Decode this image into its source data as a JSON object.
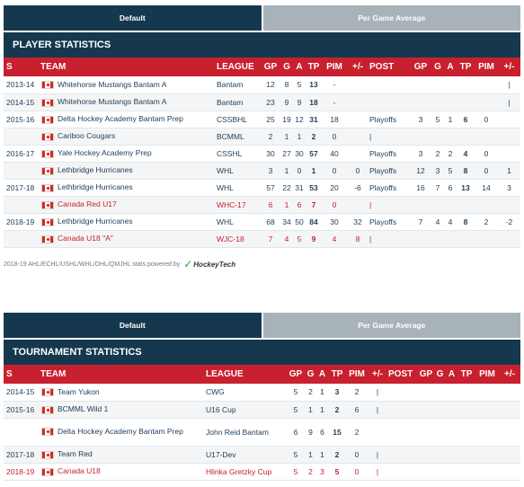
{
  "player_block": {
    "tabs": [
      "Default",
      "Per Game Average"
    ],
    "title": "PLAYER STATISTICS",
    "columns": [
      "S",
      "TEAM",
      "LEAGUE",
      "GP",
      "G",
      "A",
      "TP",
      "PIM",
      "+/-",
      "POST",
      "GP",
      "G",
      "A",
      "TP",
      "PIM",
      "+/-"
    ],
    "rows": [
      {
        "season": "2013-14",
        "team": "Whitehorse Mustangs Bantam A",
        "league": "Bantam",
        "gp": "12",
        "g": "8",
        "a": "5",
        "tp": "13",
        "pim": "-",
        "pm": "",
        "post": "",
        "pgp": "",
        "pg": "",
        "pa": "",
        "ptp": "",
        "ppim": "",
        "ppm": "|",
        "intl": false
      },
      {
        "season": "2014-15",
        "team": "Whitehorse Mustangs Bantam A",
        "league": "Bantam",
        "gp": "23",
        "g": "9",
        "a": "9",
        "tp": "18",
        "pim": "-",
        "pm": "",
        "post": "",
        "pgp": "",
        "pg": "",
        "pa": "",
        "ptp": "",
        "ppim": "",
        "ppm": "|",
        "intl": false
      },
      {
        "season": "2015-16",
        "team": "Delta Hockey Academy Bantam Prep",
        "league": "CSSBHL",
        "gp": "25",
        "g": "19",
        "a": "12",
        "tp": "31",
        "pim": "18",
        "pm": "",
        "post": "Playoffs",
        "pgp": "3",
        "pg": "5",
        "pa": "1",
        "ptp": "6",
        "ppim": "0",
        "ppm": "",
        "intl": false
      },
      {
        "season": "",
        "team": "Cariboo Cougars",
        "league": "BCMML",
        "gp": "2",
        "g": "1",
        "a": "1",
        "tp": "2",
        "pim": "0",
        "pm": "",
        "post": "|",
        "pgp": "",
        "pg": "",
        "pa": "",
        "ptp": "",
        "ppim": "",
        "ppm": "",
        "intl": false
      },
      {
        "season": "2016-17",
        "team": "Yale Hockey Academy Prep",
        "league": "CSSHL",
        "gp": "30",
        "g": "27",
        "a": "30",
        "tp": "57",
        "pim": "40",
        "pm": "",
        "post": "Playoffs",
        "pgp": "3",
        "pg": "2",
        "pa": "2",
        "ptp": "4",
        "ppim": "0",
        "ppm": "",
        "intl": false
      },
      {
        "season": "",
        "team": "Lethbridge Hurricanes",
        "league": "WHL",
        "gp": "3",
        "g": "1",
        "a": "0",
        "tp": "1",
        "pim": "0",
        "pm": "0",
        "post": "Playoffs",
        "pgp": "12",
        "pg": "3",
        "pa": "5",
        "ptp": "8",
        "ppim": "0",
        "ppm": "1",
        "intl": false
      },
      {
        "season": "2017-18",
        "team": "Lethbridge Hurricanes",
        "league": "WHL",
        "gp": "57",
        "g": "22",
        "a": "31",
        "tp": "53",
        "pim": "20",
        "pm": "-6",
        "post": "Playoffs",
        "pgp": "16",
        "pg": "7",
        "pa": "6",
        "ptp": "13",
        "ppim": "14",
        "ppm": "3",
        "intl": false
      },
      {
        "season": "",
        "team": "Canada Red U17",
        "league": "WHC-17",
        "gp": "6",
        "g": "1",
        "a": "6",
        "tp": "7",
        "pim": "0",
        "pm": "",
        "post": "|",
        "pgp": "",
        "pg": "",
        "pa": "",
        "ptp": "",
        "ppim": "",
        "ppm": "",
        "intl": true
      },
      {
        "season": "2018-19",
        "team": "Lethbridge Hurricanes",
        "league": "WHL",
        "gp": "68",
        "g": "34",
        "a": "50",
        "tp": "84",
        "pim": "30",
        "pm": "32",
        "post": "Playoffs",
        "pgp": "7",
        "pg": "4",
        "pa": "4",
        "ptp": "8",
        "ppim": "2",
        "ppm": "-2",
        "intl": false
      },
      {
        "season": "",
        "team": "Canada U18 \"A\"",
        "league": "WJC-18",
        "gp": "7",
        "g": "4",
        "a": "5",
        "tp": "9",
        "pim": "4",
        "pm": "8",
        "post": "|",
        "pgp": "",
        "pg": "",
        "pa": "",
        "ptp": "",
        "ppim": "",
        "ppm": "",
        "intl": true
      }
    ],
    "powered_text": "2018-19 AHL/ECHL/USHL/WHL/OHL/QMJHL stats powered by",
    "powered_logo": "HockeyTech"
  },
  "tournament_block": {
    "tabs": [
      "Default",
      "Per Game Average"
    ],
    "title": "TOURNAMENT STATISTICS",
    "columns": [
      "S",
      "TEAM",
      "LEAGUE",
      "GP",
      "G",
      "A",
      "TP",
      "PIM",
      "+/-",
      "POST",
      "GP",
      "G",
      "A",
      "TP",
      "PIM",
      "+/-"
    ],
    "rows": [
      {
        "season": "2014-15",
        "team": "Team Yukon",
        "league": "CWG",
        "gp": "5",
        "g": "2",
        "a": "1",
        "tp": "3",
        "pim": "2",
        "pm": "|",
        "intl": false,
        "tall": false
      },
      {
        "season": "2015-16",
        "team": "BCMML Wild 1",
        "league": "U16 Cup",
        "gp": "5",
        "g": "1",
        "a": "1",
        "tp": "2",
        "pim": "6",
        "pm": "|",
        "intl": false,
        "tall": false
      },
      {
        "season": "",
        "team": "Delta Hockey Academy Bantam Prep",
        "league": "John Reid Bantam",
        "gp": "6",
        "g": "9",
        "a": "6",
        "tp": "15",
        "pim": "2",
        "pm": "",
        "intl": false,
        "tall": true
      },
      {
        "season": "2017-18",
        "team": "Team Red",
        "league": "U17-Dev",
        "gp": "5",
        "g": "1",
        "a": "1",
        "tp": "2",
        "pim": "0",
        "pm": "|",
        "intl": false,
        "tall": false
      },
      {
        "season": "2018-19",
        "team": "Canada U18",
        "league": "Hlinka Gretzky Cup",
        "gp": "5",
        "g": "2",
        "a": "3",
        "tp": "5",
        "pim": "0",
        "pm": "|",
        "intl": true,
        "tall": false
      }
    ]
  },
  "colors": {
    "navy": "#16384f",
    "red": "#c8202f",
    "tab_inactive": "#a8b2b9"
  },
  "icons": {
    "flag": "canada-flag-icon",
    "logo": "hockeytech-logo-icon"
  }
}
